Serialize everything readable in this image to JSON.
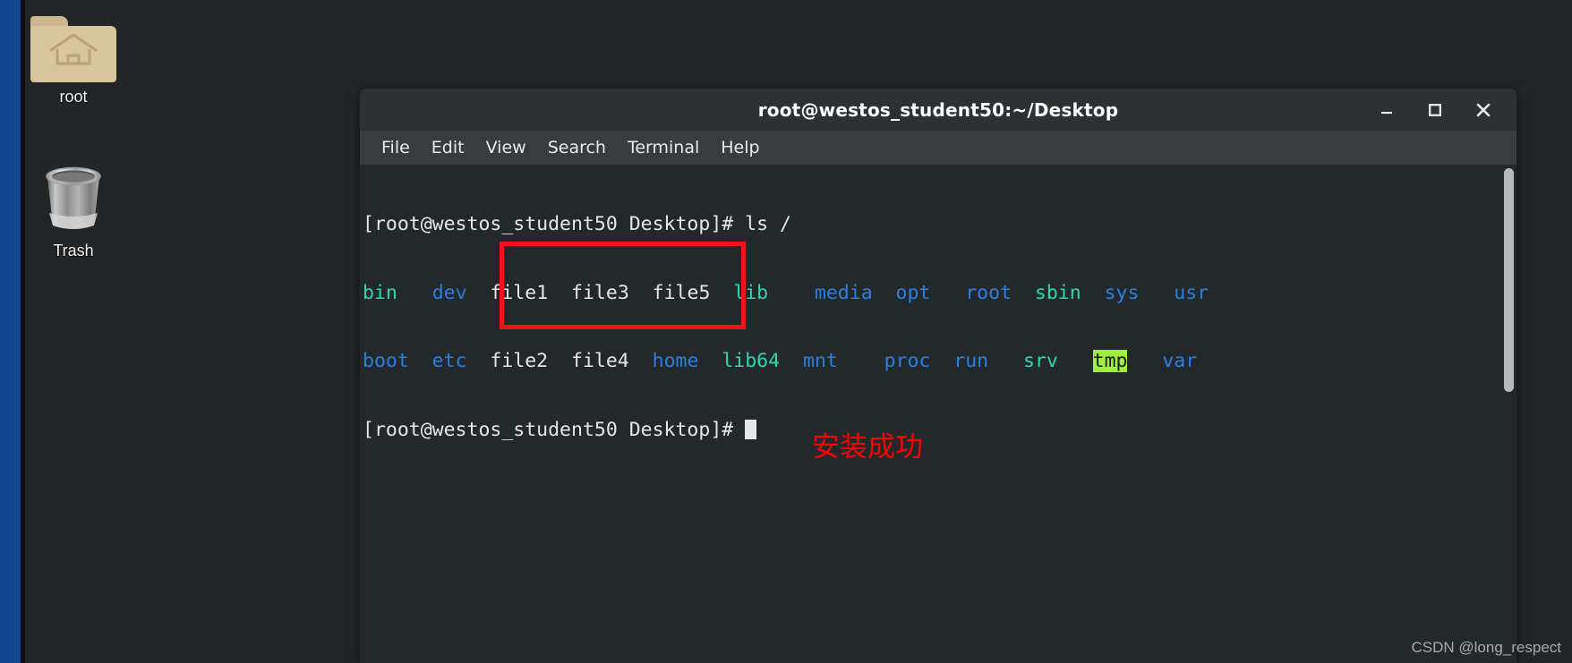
{
  "desktop": {
    "background_color": "#232527",
    "accent_strip_color": "#12478f",
    "icons": [
      {
        "name": "root",
        "label": "root",
        "icon": "home-folder-icon"
      },
      {
        "name": "trash",
        "label": "Trash",
        "icon": "trash-can-icon"
      }
    ]
  },
  "terminal": {
    "title": "root@westos_student50:~/Desktop",
    "window_controls": {
      "minimize": "minimize-icon",
      "maximize": "maximize-icon",
      "close": "close-icon"
    },
    "menu": [
      {
        "label": "File"
      },
      {
        "label": "Edit"
      },
      {
        "label": "View"
      },
      {
        "label": "Search"
      },
      {
        "label": "Terminal"
      },
      {
        "label": "Help"
      }
    ],
    "prompt": "[root@westos_student50 Desktop]# ",
    "command": "ls /",
    "prompt2": "[root@westos_student50 Desktop]# ",
    "listing_columns": [
      {
        "col": 1,
        "entries": [
          {
            "text": "bin",
            "color": "cyan"
          },
          {
            "text": "boot",
            "color": "blue"
          }
        ]
      },
      {
        "col": 2,
        "entries": [
          {
            "text": "dev",
            "color": "blue"
          },
          {
            "text": "etc",
            "color": "blue"
          }
        ]
      },
      {
        "col": 3,
        "entries": [
          {
            "text": "file1",
            "color": "white"
          },
          {
            "text": "file2",
            "color": "white"
          }
        ]
      },
      {
        "col": 4,
        "entries": [
          {
            "text": "file3",
            "color": "white"
          },
          {
            "text": "file4",
            "color": "white"
          }
        ]
      },
      {
        "col": 5,
        "entries": [
          {
            "text": "file5",
            "color": "white"
          },
          {
            "text": "home",
            "color": "blue"
          }
        ]
      },
      {
        "col": 6,
        "entries": [
          {
            "text": "lib",
            "color": "cyan"
          },
          {
            "text": "lib64",
            "color": "cyan"
          }
        ]
      },
      {
        "col": 7,
        "entries": [
          {
            "text": "media",
            "color": "blue"
          },
          {
            "text": "mnt",
            "color": "blue"
          }
        ]
      },
      {
        "col": 8,
        "entries": [
          {
            "text": "opt",
            "color": "blue"
          },
          {
            "text": "proc",
            "color": "blue"
          }
        ]
      },
      {
        "col": 9,
        "entries": [
          {
            "text": "root",
            "color": "blue"
          },
          {
            "text": "run",
            "color": "blue"
          }
        ]
      },
      {
        "col": 10,
        "entries": [
          {
            "text": "sbin",
            "color": "cyan"
          },
          {
            "text": "srv",
            "color": "cyan"
          }
        ]
      },
      {
        "col": 11,
        "entries": [
          {
            "text": "sys",
            "color": "blue"
          },
          {
            "text": "tmp",
            "color": "green-highlight"
          }
        ]
      },
      {
        "col": 12,
        "entries": [
          {
            "text": "usr",
            "color": "blue"
          },
          {
            "text": "var",
            "color": "blue"
          }
        ]
      }
    ],
    "line1": "[root@westos_student50 Desktop]# ls /",
    "line2_parts": [
      {
        "t": "bin",
        "c": "cyan"
      },
      {
        "t": "   ",
        "c": "plain"
      },
      {
        "t": "dev",
        "c": "blue"
      },
      {
        "t": "  ",
        "c": "plain"
      },
      {
        "t": "file1",
        "c": "white"
      },
      {
        "t": "  ",
        "c": "plain"
      },
      {
        "t": "file3",
        "c": "white"
      },
      {
        "t": "  ",
        "c": "plain"
      },
      {
        "t": "file5",
        "c": "white"
      },
      {
        "t": "  ",
        "c": "plain"
      },
      {
        "t": "lib",
        "c": "cyan"
      },
      {
        "t": "    ",
        "c": "plain"
      },
      {
        "t": "media",
        "c": "blue"
      },
      {
        "t": "  ",
        "c": "plain"
      },
      {
        "t": "opt",
        "c": "blue"
      },
      {
        "t": "   ",
        "c": "plain"
      },
      {
        "t": "root",
        "c": "blue"
      },
      {
        "t": "  ",
        "c": "plain"
      },
      {
        "t": "sbin",
        "c": "cyan"
      },
      {
        "t": "  ",
        "c": "plain"
      },
      {
        "t": "sys",
        "c": "blue"
      },
      {
        "t": "   ",
        "c": "plain"
      },
      {
        "t": "usr",
        "c": "blue"
      }
    ],
    "line3_parts": [
      {
        "t": "boot",
        "c": "blue"
      },
      {
        "t": "  ",
        "c": "plain"
      },
      {
        "t": "etc",
        "c": "blue"
      },
      {
        "t": "  ",
        "c": "plain"
      },
      {
        "t": "file2",
        "c": "white"
      },
      {
        "t": "  ",
        "c": "plain"
      },
      {
        "t": "file4",
        "c": "white"
      },
      {
        "t": "  ",
        "c": "plain"
      },
      {
        "t": "home",
        "c": "blue"
      },
      {
        "t": "  ",
        "c": "plain"
      },
      {
        "t": "lib64",
        "c": "cyan"
      },
      {
        "t": "  ",
        "c": "plain"
      },
      {
        "t": "mnt",
        "c": "blue"
      },
      {
        "t": "    ",
        "c": "plain"
      },
      {
        "t": "proc",
        "c": "blue"
      },
      {
        "t": "  ",
        "c": "plain"
      },
      {
        "t": "run",
        "c": "blue"
      },
      {
        "t": "   ",
        "c": "plain"
      },
      {
        "t": "srv",
        "c": "cyan"
      },
      {
        "t": "   ",
        "c": "plain"
      },
      {
        "t": "tmp",
        "c": "tmp"
      },
      {
        "t": "   ",
        "c": "plain"
      },
      {
        "t": "var",
        "c": "blue"
      }
    ],
    "cursor": "block-cursor",
    "scrollbar": "vertical-scrollbar"
  },
  "annotations": {
    "box_color": "#f21414",
    "text": "安装成功",
    "text_color": "#ff0000"
  },
  "watermark": {
    "text": "CSDN @long_respect"
  }
}
